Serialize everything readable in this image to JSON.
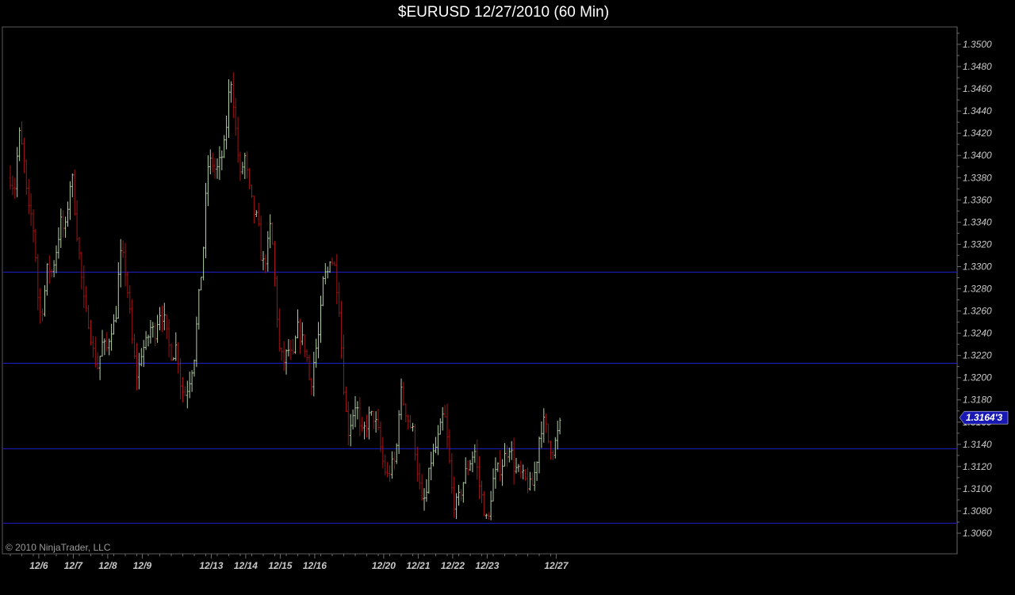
{
  "chart_data": {
    "type": "ohlc",
    "title": "$EURUSD  12/27/2010 (60 Min)",
    "symbol": "$EURUSD",
    "interval": "60 Min",
    "ylim": [
      1.305,
      1.351
    ],
    "y_ticks": [
      "1.3060",
      "1.3080",
      "1.3100",
      "1.3120",
      "1.3140",
      "1.3160",
      "1.3180",
      "1.3200",
      "1.3220",
      "1.3240",
      "1.3260",
      "1.3280",
      "1.3300",
      "1.3320",
      "1.3340",
      "1.3360",
      "1.3380",
      "1.3400",
      "1.3420",
      "1.3440",
      "1.3460",
      "1.3480",
      "1.3500"
    ],
    "x_ticks": [
      {
        "label": "12/6",
        "bar": 1
      },
      {
        "label": "12/7",
        "bar": 16
      },
      {
        "label": "12/8",
        "bar": 31
      },
      {
        "label": "12/9",
        "bar": 46
      },
      {
        "label": "12/13",
        "bar": 76
      },
      {
        "label": "12/14",
        "bar": 91
      },
      {
        "label": "12/15",
        "bar": 106
      },
      {
        "label": "12/16",
        "bar": 121
      },
      {
        "label": "12/20",
        "bar": 151
      },
      {
        "label": "12/21",
        "bar": 166
      },
      {
        "label": "12/22",
        "bar": 181
      },
      {
        "label": "12/23",
        "bar": 196
      },
      {
        "label": "12/27",
        "bar": 226
      }
    ],
    "bar_count": 238,
    "grid": false,
    "horizontal_lines": [
      1.3295,
      1.3213,
      1.3136,
      1.3069
    ],
    "last_price_label": "1.3164'3",
    "last_price": 1.3164,
    "anchors": [
      [
        0,
        1.338
      ],
      [
        2,
        1.337
      ],
      [
        4,
        1.342
      ],
      [
        6,
        1.34
      ],
      [
        8,
        1.335
      ],
      [
        10,
        1.3345
      ],
      [
        12,
        1.33
      ],
      [
        13,
        1.3255
      ],
      [
        15,
        1.3265
      ],
      [
        17,
        1.33
      ],
      [
        19,
        1.3295
      ],
      [
        21,
        1.3315
      ],
      [
        23,
        1.334
      ],
      [
        25,
        1.333
      ],
      [
        27,
        1.337
      ],
      [
        28,
        1.3385
      ],
      [
        30,
        1.334
      ],
      [
        32,
        1.33
      ],
      [
        34,
        1.326
      ],
      [
        36,
        1.325
      ],
      [
        38,
        1.322
      ],
      [
        40,
        1.321
      ],
      [
        42,
        1.323
      ],
      [
        44,
        1.3225
      ],
      [
        46,
        1.3245
      ],
      [
        48,
        1.325
      ],
      [
        50,
        1.331
      ],
      [
        52,
        1.3305
      ],
      [
        54,
        1.327
      ],
      [
        56,
        1.3225
      ],
      [
        58,
        1.32
      ],
      [
        60,
        1.3225
      ],
      [
        62,
        1.323
      ],
      [
        64,
        1.3245
      ],
      [
        66,
        1.324
      ],
      [
        68,
        1.326
      ],
      [
        70,
        1.3255
      ],
      [
        72,
        1.323
      ],
      [
        74,
        1.322
      ],
      [
        76,
        1.323
      ],
      [
        78,
        1.319
      ],
      [
        80,
        1.3185
      ],
      [
        82,
        1.32
      ],
      [
        84,
        1.322
      ],
      [
        86,
        1.327
      ],
      [
        88,
        1.331
      ],
      [
        90,
        1.339
      ],
      [
        92,
        1.3395
      ],
      [
        94,
        1.3385
      ],
      [
        96,
        1.3395
      ],
      [
        98,
        1.341
      ],
      [
        100,
        1.346
      ],
      [
        101,
        1.347
      ],
      [
        103,
        1.342
      ],
      [
        105,
        1.338
      ],
      [
        107,
        1.34
      ],
      [
        109,
        1.337
      ],
      [
        111,
        1.335
      ],
      [
        113,
        1.334
      ],
      [
        115,
        1.33
      ],
      [
        117,
        1.331
      ],
      [
        119,
        1.334
      ],
      [
        121,
        1.328
      ],
      [
        123,
        1.322
      ],
      [
        125,
        1.3215
      ],
      [
        127,
        1.3225
      ],
      [
        129,
        1.3215
      ],
      [
        131,
        1.3245
      ],
      [
        133,
        1.3235
      ],
      [
        135,
        1.3225
      ],
      [
        137,
        1.319
      ],
      [
        139,
        1.322
      ],
      [
        141,
        1.324
      ],
      [
        143,
        1.329
      ],
      [
        145,
        1.3295
      ],
      [
        146,
        1.331
      ],
      [
        148,
        1.33
      ],
      [
        150,
        1.327
      ],
      [
        152,
        1.32
      ],
      [
        154,
        1.315
      ],
      [
        156,
        1.3165
      ],
      [
        158,
        1.318
      ],
      [
        160,
        1.3145
      ],
      [
        162,
        1.3155
      ],
      [
        164,
        1.3165
      ],
      [
        166,
        1.3165
      ],
      [
        168,
        1.315
      ],
      [
        170,
        1.3125
      ],
      [
        172,
        1.311
      ],
      [
        174,
        1.312
      ],
      [
        176,
        1.3125
      ],
      [
        178,
        1.319
      ],
      [
        180,
        1.3175
      ],
      [
        182,
        1.316
      ],
      [
        184,
        1.315
      ],
      [
        186,
        1.3115
      ],
      [
        188,
        1.3085
      ],
      [
        190,
        1.3095
      ],
      [
        192,
        1.3125
      ],
      [
        194,
        1.3135
      ],
      [
        196,
        1.315
      ],
      [
        198,
        1.317
      ],
      [
        200,
        1.3135
      ],
      [
        202,
        1.309
      ],
      [
        204,
        1.3085
      ],
      [
        206,
        1.31
      ],
      [
        208,
        1.3115
      ],
      [
        210,
        1.3125
      ],
      [
        212,
        1.3135
      ],
      [
        214,
        1.3105
      ],
      [
        216,
        1.3085
      ],
      [
        218,
        1.3065
      ],
      [
        220,
        1.3105
      ],
      [
        222,
        1.3115
      ],
      [
        224,
        1.312
      ],
      [
        226,
        1.313
      ],
      [
        228,
        1.314
      ],
      [
        230,
        1.312
      ],
      [
        232,
        1.3115
      ],
      [
        234,
        1.311
      ],
      [
        236,
        1.3105
      ],
      [
        238,
        1.31
      ],
      [
        240,
        1.312
      ],
      [
        242,
        1.3155
      ],
      [
        244,
        1.316
      ],
      [
        246,
        1.314
      ],
      [
        248,
        1.3135
      ],
      [
        250,
        1.315
      ],
      [
        252,
        1.3164
      ]
    ]
  },
  "copyright": "© 2010 NinjaTrader, LLC",
  "colors": {
    "background": "#000000",
    "up_bar": "#b3d0a6",
    "down_bar": "#a31313",
    "hline": "#1f1fc8",
    "axis": "#6a6a6a",
    "price_label_bg": "#1818b4"
  }
}
